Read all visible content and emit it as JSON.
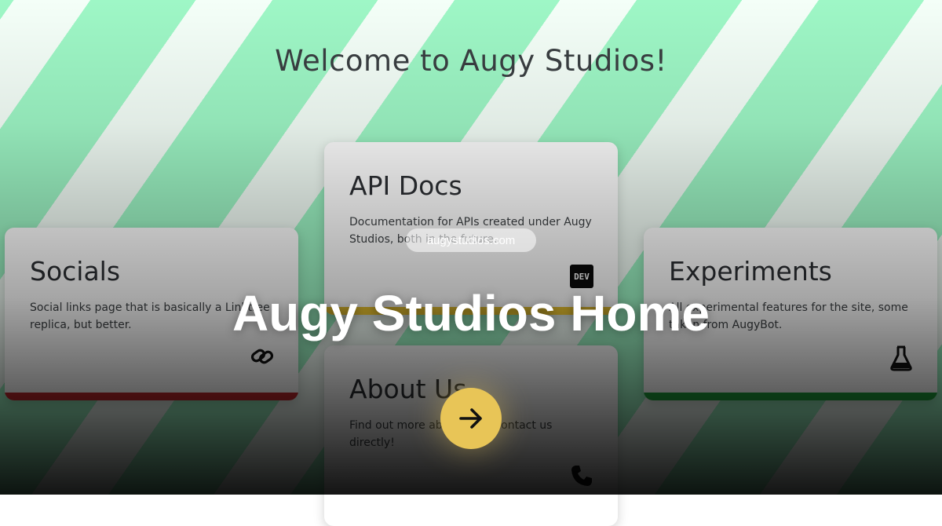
{
  "page": {
    "title": "Welcome to Augy Studios!",
    "domain": "augystudios.com",
    "headline": "Augy Studios Home"
  },
  "cards": {
    "socials": {
      "title": "Socials",
      "description": "Social links page that is basically a Linktree replica, but better.",
      "icon": "link-icon",
      "bar_color": "#c0282d"
    },
    "api_docs": {
      "title": "API Docs",
      "description": "Documentation for APIs created under Augy Studios, both in the future.",
      "icon": "dev-icon",
      "icon_text": "DEV",
      "bar_color": "#e8c230"
    },
    "experiments": {
      "title": "Experiments",
      "description": "All experimental features for the site, some taken from AugyBot.",
      "icon": "flask-icon",
      "bar_color": "#1e9e3a"
    },
    "about": {
      "title": "About Us",
      "description": "Find out more about us or contact us directly!",
      "icon": "phone-icon"
    }
  },
  "go_button": {
    "icon": "arrow-right-icon",
    "color": "#e8c557"
  }
}
